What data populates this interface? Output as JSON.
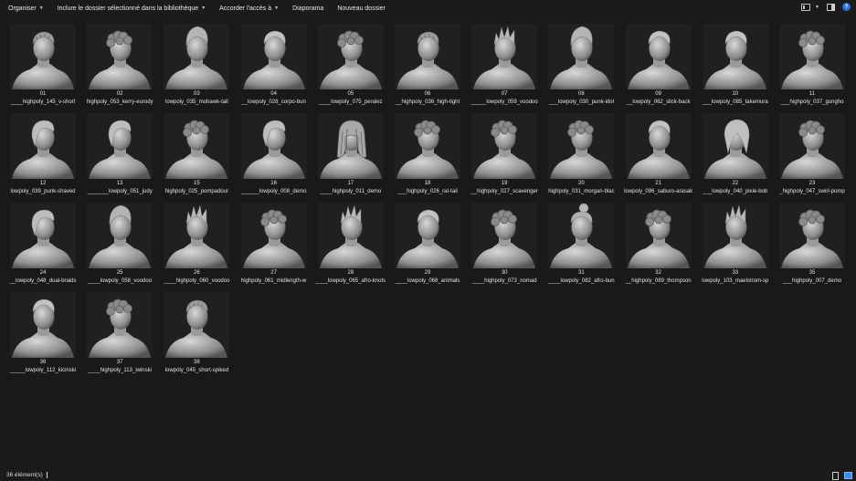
{
  "toolbar": {
    "organize": "Organiser",
    "include": "Inclure le dossier sélectionné dans la bibliothèque",
    "share": "Accorder l'accès à",
    "slideshow": "Diaporama",
    "new_folder": "Nouveau dossier",
    "help": "?"
  },
  "files": [
    {
      "num": "01",
      "name": "____highpoly_145_v-short",
      "style": "short"
    },
    {
      "num": "02",
      "name": "highpoly_053_kerry-eurody",
      "style": "curly"
    },
    {
      "num": "03",
      "name": "lowpoly_035_mohawk-tall",
      "style": "tall"
    },
    {
      "num": "04",
      "name": "__lowpoly_028_corpo-bun",
      "style": "smooth"
    },
    {
      "num": "05",
      "name": "____lowpoly_075_peralez",
      "style": "curly"
    },
    {
      "num": "06",
      "name": "__highpoly_036_high-tight",
      "style": "short"
    },
    {
      "num": "07",
      "name": "_____lowpoly_059_voodoo",
      "style": "spiky"
    },
    {
      "num": "08",
      "name": "___lowpoly_030_punk-idol",
      "style": "tall"
    },
    {
      "num": "09",
      "name": "__lowpoly_062_slick-back",
      "style": "smooth"
    },
    {
      "num": "10",
      "name": "___lowpoly_085_takemura",
      "style": "smooth"
    },
    {
      "num": "11",
      "name": "___highpoly_037_gungho",
      "style": "curly"
    },
    {
      "num": "12",
      "name": "lowpoly_039_punk-shaved",
      "style": "side"
    },
    {
      "num": "13",
      "name": "_______lowpoly_051_judy",
      "style": "side"
    },
    {
      "num": "15",
      "name": "highpoly_025_pompadour",
      "style": "curly"
    },
    {
      "num": "16",
      "name": "______lowpoly_008_demo",
      "style": "side"
    },
    {
      "num": "17",
      "name": "____highpoly_011_demo",
      "style": "long"
    },
    {
      "num": "18",
      "name": "___highpoly_026_rat-tail",
      "style": "curly"
    },
    {
      "num": "19",
      "name": "__highpoly_027_scavenger",
      "style": "curly"
    },
    {
      "num": "20",
      "name": "highpoly_031_morgan-blac",
      "style": "curly"
    },
    {
      "num": "21",
      "name": "lowpoly_096_saburo-arasak",
      "style": "smooth"
    },
    {
      "num": "22",
      "name": "___lowpoly_040_pixie-bob",
      "style": "bob"
    },
    {
      "num": "23",
      "name": "_highpoly_047_swirl-pomp",
      "style": "curly"
    },
    {
      "num": "24",
      "name": "__lowpoly_048_dual-braids",
      "style": "side"
    },
    {
      "num": "25",
      "name": "____lowpoly_058_voodoo",
      "style": "tall"
    },
    {
      "num": "26",
      "name": "____highpoly_060_voodoo",
      "style": "spiky"
    },
    {
      "num": "27",
      "name": "highpoly_061_midlength-w",
      "style": "curly"
    },
    {
      "num": "28",
      "name": "____lowpoly_065_afro-knots",
      "style": "spiky"
    },
    {
      "num": "29",
      "name": "____lowpoly_068_animals",
      "style": "smooth"
    },
    {
      "num": "30",
      "name": "____highpoly_073_nomad",
      "style": "curly"
    },
    {
      "num": "31",
      "name": "____lowpoly_082_afro-bun",
      "style": "bun"
    },
    {
      "num": "32",
      "name": "__highpoly_089_thompson",
      "style": "curly"
    },
    {
      "num": "33",
      "name": "lowpoly_103_maelstrom-sp",
      "style": "spiky"
    },
    {
      "num": "35",
      "name": "___highpoly_007_demo",
      "style": "curly"
    },
    {
      "num": "36",
      "name": "_____lowpoly_112_kicinski",
      "style": "smooth"
    },
    {
      "num": "37",
      "name": "____highpoly_113_iwinski",
      "style": "curly"
    },
    {
      "num": "38",
      "name": "lowpoly_045_short-spiked",
      "style": "short"
    }
  ],
  "status": {
    "count": "36 élément(s)"
  },
  "icons": {
    "view_menu": "view-options-icon",
    "preview_pane": "preview-pane-icon",
    "help": "help-icon",
    "details_view": "details-view-icon",
    "large_icons_view": "large-icons-view-icon"
  }
}
